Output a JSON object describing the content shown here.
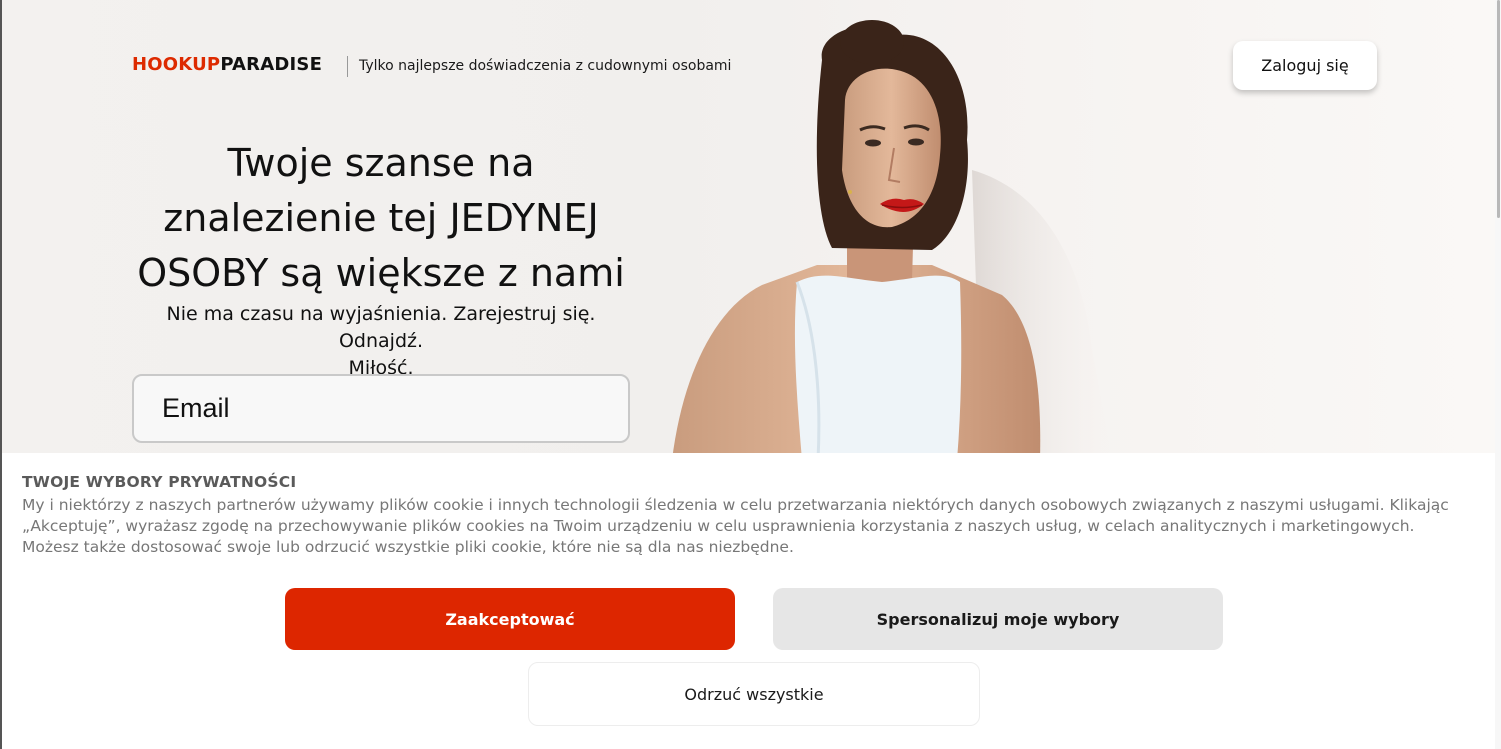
{
  "header": {
    "logo_part1": "HOOKUP",
    "logo_part2": "PARADISE",
    "tagline": "Tylko najlepsze doświadczenia z cudownymi osobami",
    "login_label": "Zaloguj się"
  },
  "hero": {
    "title_line1": "Twoje szanse na",
    "title_line2": "znalezienie tej JEDYNEJ",
    "title_line3": "OSOBY są większe z nami",
    "subtitle_line1": "Nie ma czasu na wyjaśnienia. Zarejestruj się. Odnajdź.",
    "subtitle_line2": "Miłość.",
    "email_placeholder": "Email"
  },
  "cookie": {
    "title": "TWOJE WYBORY PRYWATNOŚCI",
    "text": "My i niektórzy z naszych partnerów używamy plików cookie i innych technologii śledzenia w celu przetwarzania niektórych danych osobowych związanych z naszymi usługami. Klikając „Akceptuję”, wyrażasz zgodę na przechowywanie plików cookies na Twoim urządzeniu w celu usprawnienia korzystania z naszych usług, w celach analitycznych i marketingowych. Możesz także dostosować swoje lub odrzucić wszystkie pliki cookie, które nie są dla nas niezbędne.",
    "accept_label": "Zaakceptować",
    "customize_label": "Spersonalizuj moje wybory",
    "reject_label": "Odrzuć wszystkie"
  },
  "colors": {
    "brand_red": "#dd2600",
    "button_grey": "#e6e6e6"
  }
}
